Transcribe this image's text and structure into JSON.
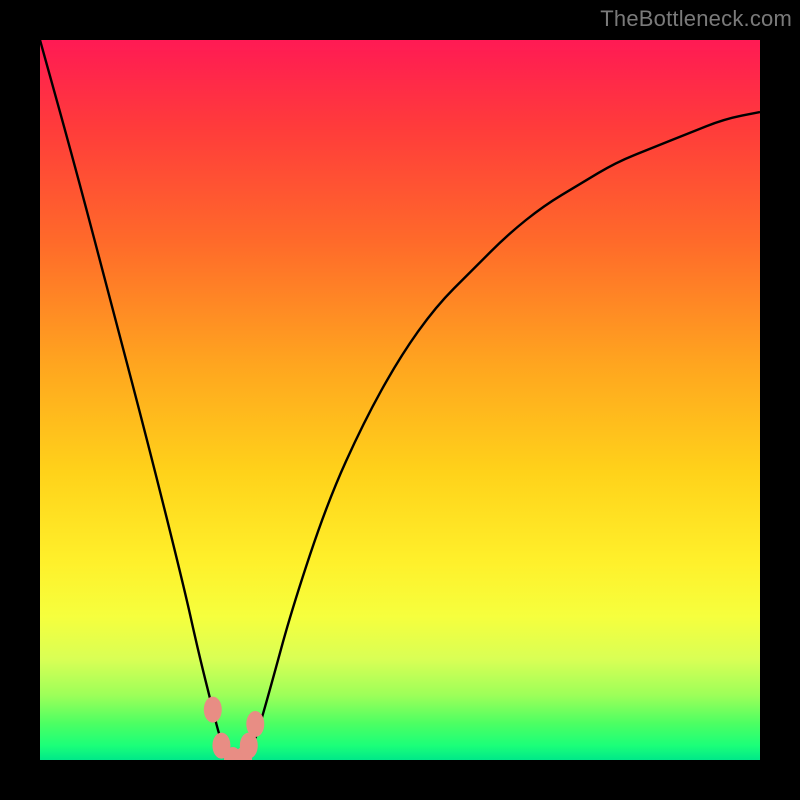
{
  "watermark": "TheBottleneck.com",
  "chart_data": {
    "type": "line",
    "title": "",
    "xlabel": "",
    "ylabel": "",
    "ylim": [
      0,
      100
    ],
    "xlim": [
      0,
      100
    ],
    "x": [
      0,
      5,
      10,
      15,
      20,
      22,
      24,
      25,
      26,
      27,
      28,
      29,
      30,
      32,
      35,
      40,
      45,
      50,
      55,
      60,
      65,
      70,
      75,
      80,
      85,
      90,
      95,
      100
    ],
    "values": [
      100,
      82,
      63,
      44,
      24,
      15,
      7,
      3,
      1,
      0,
      0,
      1,
      3,
      10,
      21,
      36,
      47,
      56,
      63,
      68,
      73,
      77,
      80,
      83,
      85,
      87,
      89,
      90
    ],
    "markers_x": [
      24.0,
      25.2,
      26.8,
      28.2,
      29.0,
      29.9
    ],
    "markers_y": [
      7,
      2,
      0,
      0,
      2,
      5
    ],
    "gradient_stops": [
      {
        "pos": 0.0,
        "color": "#ff1a54"
      },
      {
        "pos": 0.5,
        "color": "#ffb81f"
      },
      {
        "pos": 0.8,
        "color": "#f6ff3d"
      },
      {
        "pos": 1.0,
        "color": "#00e889"
      }
    ]
  }
}
